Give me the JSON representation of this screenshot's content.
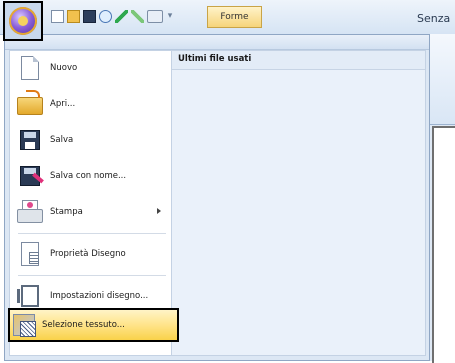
{
  "window": {
    "title": "Senza",
    "ribbon_tab": "Forme",
    "qat_dropdown_glyph": "▾"
  },
  "quick_access": [
    "new-icon",
    "open-icon",
    "save-icon",
    "zoom-icon",
    "undo-icon",
    "redo-icon",
    "view-icon"
  ],
  "menu": {
    "recent_header": "Ultimi file usati",
    "items": [
      {
        "label": "Nuovo",
        "icon": "new-document-icon"
      },
      {
        "label": "Apri...",
        "icon": "open-folder-icon"
      },
      {
        "label": "Salva",
        "icon": "save-disk-icon"
      },
      {
        "label": "Salva con nome...",
        "icon": "save-as-icon"
      },
      {
        "label": "Stampa",
        "icon": "printer-icon",
        "submenu": true
      },
      {
        "label": "Proprietà Disegno",
        "icon": "design-properties-icon"
      },
      {
        "label": "Impostazioni disegno...",
        "icon": "design-settings-icon"
      },
      {
        "label": "Selezione tessuto...",
        "icon": "fabric-selection-icon",
        "highlighted": true
      }
    ]
  },
  "colors": {
    "highlight": "#f9d24a",
    "menu_background": "#dce7f4"
  }
}
